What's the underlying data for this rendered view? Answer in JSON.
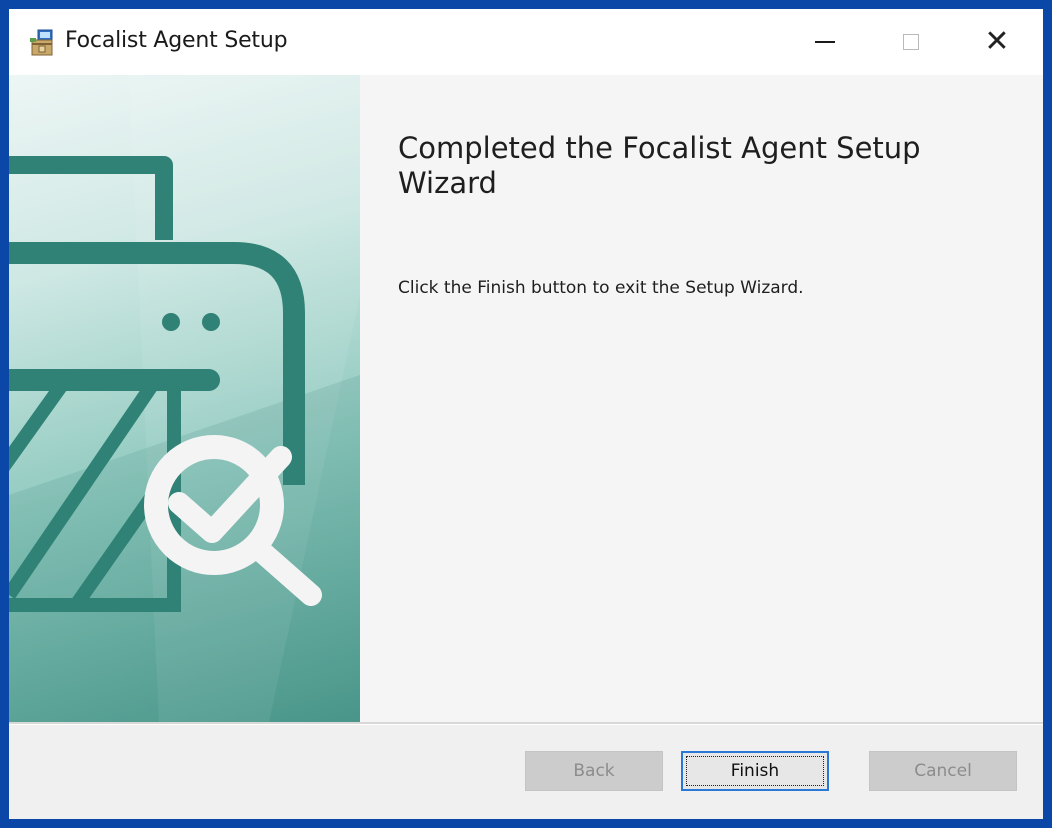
{
  "window": {
    "title": "Focalist Agent Setup",
    "icon": "installer-icon"
  },
  "titlebar_controls": {
    "minimize_icon": "minimize-icon",
    "maximize_icon": "maximize-icon",
    "close_icon": "close-icon",
    "close_glyph": "✕"
  },
  "banner": {
    "icon": "printer-check-magnifier-icon",
    "accent_color": "#2f8275"
  },
  "content": {
    "heading": "Completed the Focalist Agent Setup Wizard",
    "description": "Click the Finish button to exit the Setup Wizard."
  },
  "buttons": {
    "back_label": "Back",
    "finish_label": "Finish",
    "cancel_label": "Cancel"
  }
}
